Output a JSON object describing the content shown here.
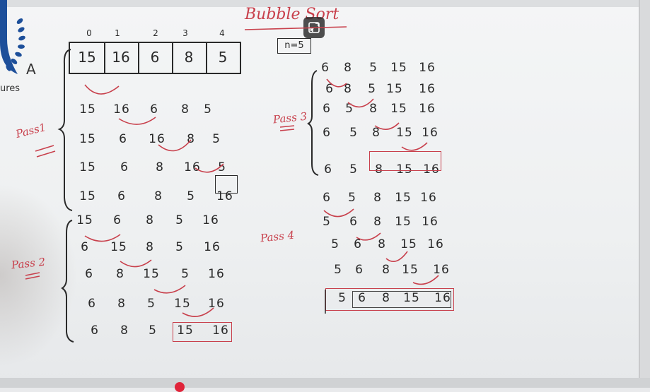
{
  "logo": {
    "letter": "A",
    "text": "ures"
  },
  "title": "Bubble Sort",
  "n_label": "n=5",
  "indices": [
    "0",
    "1",
    "2",
    "3",
    "4"
  ],
  "array": [
    "15",
    "16",
    "6",
    "8",
    "5"
  ],
  "pass_labels": {
    "pass1": "Pass1",
    "pass2": "Pass 2",
    "pass3": "Pass 3",
    "pass4": "Pass 4"
  },
  "pass1": [
    [
      "15",
      "16",
      "6",
      "8",
      "5"
    ],
    [
      "15",
      "6",
      "16",
      "8",
      "5"
    ],
    [
      "15",
      "6",
      "8",
      "16",
      "5"
    ],
    [
      "15",
      "6",
      "8",
      "5",
      "16"
    ]
  ],
  "pass2": [
    [
      "15",
      "6",
      "8",
      "5",
      "16"
    ],
    [
      "6",
      "15",
      "8",
      "5",
      "16"
    ],
    [
      "6",
      "8",
      "15",
      "5",
      "16"
    ],
    [
      "6",
      "8",
      "5",
      "15",
      "16"
    ],
    [
      "6",
      "8",
      "5",
      "15",
      "16"
    ]
  ],
  "pass3": [
    [
      "6",
      "8",
      "5",
      "15",
      "16"
    ],
    [
      "6",
      "8",
      "5",
      "15",
      "16"
    ],
    [
      "6",
      "5",
      "8",
      "15",
      "16"
    ],
    [
      "6",
      "5",
      "8",
      "15",
      "16"
    ],
    [
      "6",
      "5",
      "8",
      "15",
      "16"
    ]
  ],
  "pass4": [
    [
      "6",
      "5",
      "8",
      "15",
      "16"
    ],
    [
      "5",
      "6",
      "8",
      "15",
      "16"
    ],
    [
      "5",
      "6",
      "8",
      "15",
      "16"
    ],
    [
      "5",
      "6",
      "8",
      "15",
      "16"
    ],
    [
      "5",
      "6",
      "8",
      "15",
      "16"
    ]
  ],
  "colors": {
    "ink": "#2a2a2a",
    "marker_red": "#c8404c",
    "record_dot": "#e0243a"
  },
  "icons": {
    "restore": "exit-fullscreen-icon"
  }
}
